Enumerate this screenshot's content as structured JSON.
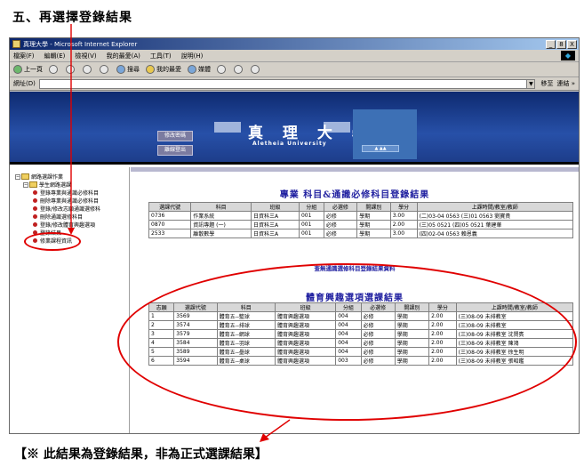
{
  "step_title": "五、再選擇登錄結果",
  "note": "【※ 此結果為登錄結果，非為正式選課結果】",
  "browser": {
    "title": "真理大學 - Microsoft Internet Explorer",
    "window_buttons": [
      "_",
      "8",
      "X"
    ],
    "menu": [
      "檔案(F)",
      "編輯(E)",
      "檢視(V)",
      "我的最愛(A)",
      "工具(T)",
      "說明(H)"
    ],
    "toolbar": {
      "back": "上一頁",
      "search": "搜尋",
      "favorites": "我的最愛",
      "media": "媒體"
    },
    "address_label": "網址(D)",
    "go_label": "移至",
    "links_label": "連結 »"
  },
  "banner": {
    "buttons": [
      "修改密碼",
      "離線登出"
    ],
    "university_name": "真 理 大 學",
    "university_en": "Aletheia University"
  },
  "sidebar": {
    "root": "網路選課作業",
    "group": "學生網路選課",
    "items": [
      "登錄專業與通識必修科目",
      "刪除專業與通識必修科目",
      "登錄/修改志願通識選修科",
      "刪除通識選修科目",
      "登錄/修改體育興趣選項",
      "登錄結果",
      "修業課程資訊"
    ]
  },
  "section1": {
    "title": "專業 科目&通識必修科目登錄結果",
    "headers": [
      "選課代號",
      "科目",
      "班級",
      "分組",
      "必選修",
      "開課別",
      "學分",
      "上課時間/教室/教師"
    ],
    "rows": [
      [
        "0736",
        "作業系統",
        "日資科三A",
        "001",
        "必修",
        "學期",
        "3.00",
        "(二)03-04 0563 (三)01 0563 劉寶貴"
      ],
      [
        "0870",
        "資訊專題 (一)",
        "日資科三A",
        "001",
        "必修",
        "學期",
        "2.00",
        "(三)05 0521 (四)05 0521 葉建華"
      ],
      [
        "2533",
        "離散數學",
        "日資科三A",
        "001",
        "必修",
        "學期",
        "3.00",
        "(四)02-04 0563 賴恩義"
      ]
    ]
  },
  "section2": {
    "title": "查無通識選修科目登錄結果資料"
  },
  "section3": {
    "title": "體育興趣選項選課結果",
    "headers": [
      "志願",
      "選課代號",
      "科目",
      "班級",
      "分組",
      "必選修",
      "開課別",
      "學分",
      "上課時間/教室/教師"
    ],
    "rows": [
      [
        "1",
        "3569",
        "體育五--籃球",
        "體育興趣選項",
        "004",
        "必修",
        "學期",
        "2.00",
        "(三)08-09 未排教室"
      ],
      [
        "2",
        "3574",
        "體育五--排球",
        "體育興趣選項",
        "004",
        "必修",
        "學期",
        "2.00",
        "(三)08-09 未排教室"
      ],
      [
        "3",
        "3579",
        "體育五--網球",
        "體育興趣選項",
        "004",
        "必修",
        "學期",
        "2.00",
        "(三)08-09 未排教室 沈賢賓"
      ],
      [
        "4",
        "3584",
        "體育五--羽球",
        "體育興趣選項",
        "004",
        "必修",
        "學期",
        "2.00",
        "(三)08-09 未排教室 陳鴻"
      ],
      [
        "5",
        "3589",
        "體育五--壘球",
        "體育興趣選項",
        "004",
        "必修",
        "學期",
        "2.00",
        "(三)08-09 未排教室 徐生明"
      ],
      [
        "6",
        "3594",
        "體育五--桌球",
        "體育興趣選項",
        "003",
        "必修",
        "學期",
        "2.00",
        "(三)08-09 未排教室 張昭鑑"
      ]
    ]
  },
  "colors": {
    "annotation": "#e00000",
    "banner": "#1d3d8a",
    "section_title": "#2020a0"
  }
}
